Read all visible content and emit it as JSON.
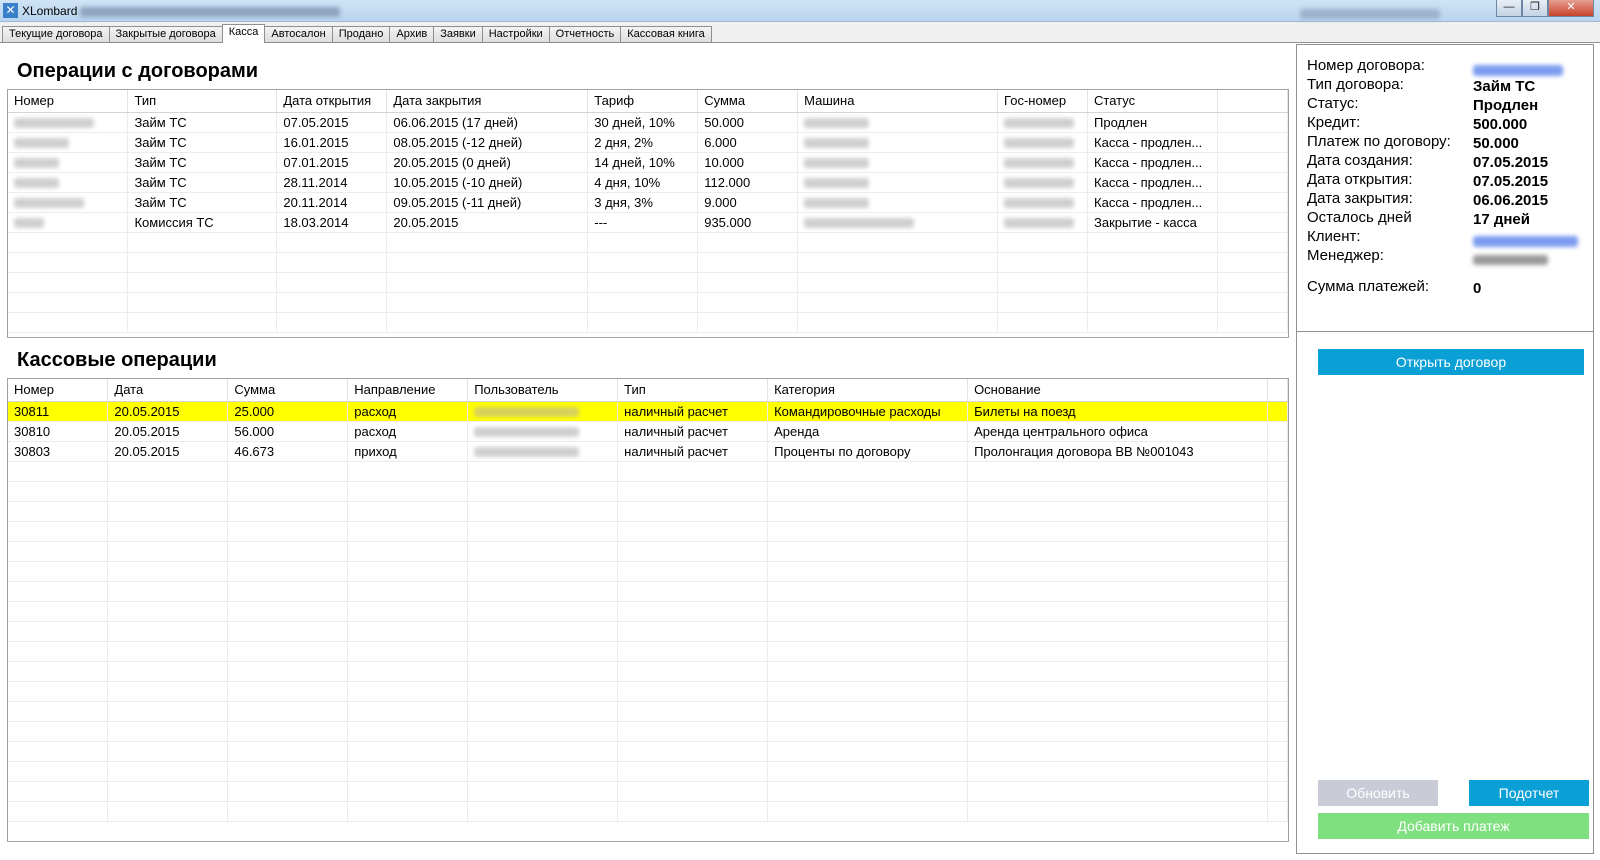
{
  "window": {
    "app_name": "XLombard",
    "min_label": "—",
    "max_label": "❐",
    "close_label": "✕"
  },
  "tabs": [
    {
      "label": "Текущие договора"
    },
    {
      "label": "Закрытые договора"
    },
    {
      "label": "Касса"
    },
    {
      "label": "Автосалон"
    },
    {
      "label": "Продано"
    },
    {
      "label": "Архив"
    },
    {
      "label": "Заявки"
    },
    {
      "label": "Настройки"
    },
    {
      "label": "Отчетность"
    },
    {
      "label": "Кассовая книга"
    }
  ],
  "contracts": {
    "title": "Операции с договорами",
    "columns": [
      "Номер",
      "Тип",
      "Дата открытия",
      "Дата закрытия",
      "Тариф",
      "Сумма",
      "Машина",
      "Гос-номер",
      "Статус"
    ],
    "rows": [
      {
        "type": "Займ ТС",
        "opened": "07.05.2015",
        "closed": "06.06.2015 (17 дней)",
        "tariff": "30 дней, 10%",
        "sum": "50.000",
        "status": "Продлен"
      },
      {
        "type": "Займ ТС",
        "opened": "16.01.2015",
        "closed": "08.05.2015 (-12 дней)",
        "tariff": "2 дня, 2%",
        "sum": "6.000",
        "status": "Касса - продлен..."
      },
      {
        "type": "Займ ТС",
        "opened": "07.01.2015",
        "closed": "20.05.2015 (0 дней)",
        "tariff": "14 дней, 10%",
        "sum": "10.000",
        "status": "Касса - продлен..."
      },
      {
        "type": "Займ ТС",
        "opened": "28.11.2014",
        "closed": "10.05.2015 (-10 дней)",
        "tariff": "4 дня, 10%",
        "sum": "112.000",
        "status": "Касса - продлен..."
      },
      {
        "type": "Займ ТС",
        "opened": "20.11.2014",
        "closed": "09.05.2015 (-11 дней)",
        "tariff": "3 дня, 3%",
        "sum": "9.000",
        "status": "Касса - продлен..."
      },
      {
        "type": "Комиссия ТС",
        "opened": "18.03.2014",
        "closed": "20.05.2015",
        "tariff": "---",
        "sum": "935.000",
        "status": "Закрытие - касса"
      }
    ]
  },
  "cash": {
    "title": "Кассовые операции",
    "columns": [
      "Номер",
      "Дата",
      "Сумма",
      "Направление",
      "Пользователь",
      "Тип",
      "Категория",
      "Основание"
    ],
    "rows": [
      {
        "number": "30811",
        "date": "20.05.2015",
        "sum": "25.000",
        "direction": "расход",
        "type": "наличный расчет",
        "category": "Командировочные расходы",
        "basis": "Билеты на поезд"
      },
      {
        "number": "30810",
        "date": "20.05.2015",
        "sum": "56.000",
        "direction": "расход",
        "type": "наличный расчет",
        "category": "Аренда",
        "basis": "Аренда центрального офиса"
      },
      {
        "number": "30803",
        "date": "20.05.2015",
        "sum": "46.673",
        "direction": "приход",
        "type": "наличный расчет",
        "category": "Проценты по договору",
        "basis": "Пролонгация договора ВВ №001043"
      }
    ]
  },
  "info": {
    "contract_number_label": "Номер договора:",
    "contract_type_label": "Тип договора:",
    "contract_type": "Займ ТС",
    "status_label": "Статус:",
    "status": "Продлен",
    "credit_label": "Кредит:",
    "credit": "500.000",
    "payment_label": "Платеж по договору:",
    "payment": "50.000",
    "created_label": "Дата создания:",
    "created": "07.05.2015",
    "opened_label": "Дата открытия:",
    "opened": "07.05.2015",
    "closed_label": "Дата закрытия:",
    "closed": "06.06.2015",
    "days_left_label": "Осталось дней",
    "days_left": "17 дней",
    "client_label": "Клиент:",
    "manager_label": "Менеджер:",
    "payments_sum_label": "Сумма платежей:",
    "payments_sum": "0"
  },
  "buttons": {
    "open_contract": "Открыть договор",
    "refresh": "Обновить",
    "report": "Подотчет",
    "add_payment": "Добавить платеж"
  },
  "colors": {
    "accent": "#0aa0d6",
    "highlight": "#ffff00",
    "add_button": "#7fe07f",
    "disabled_button": "#c9ccd6"
  }
}
